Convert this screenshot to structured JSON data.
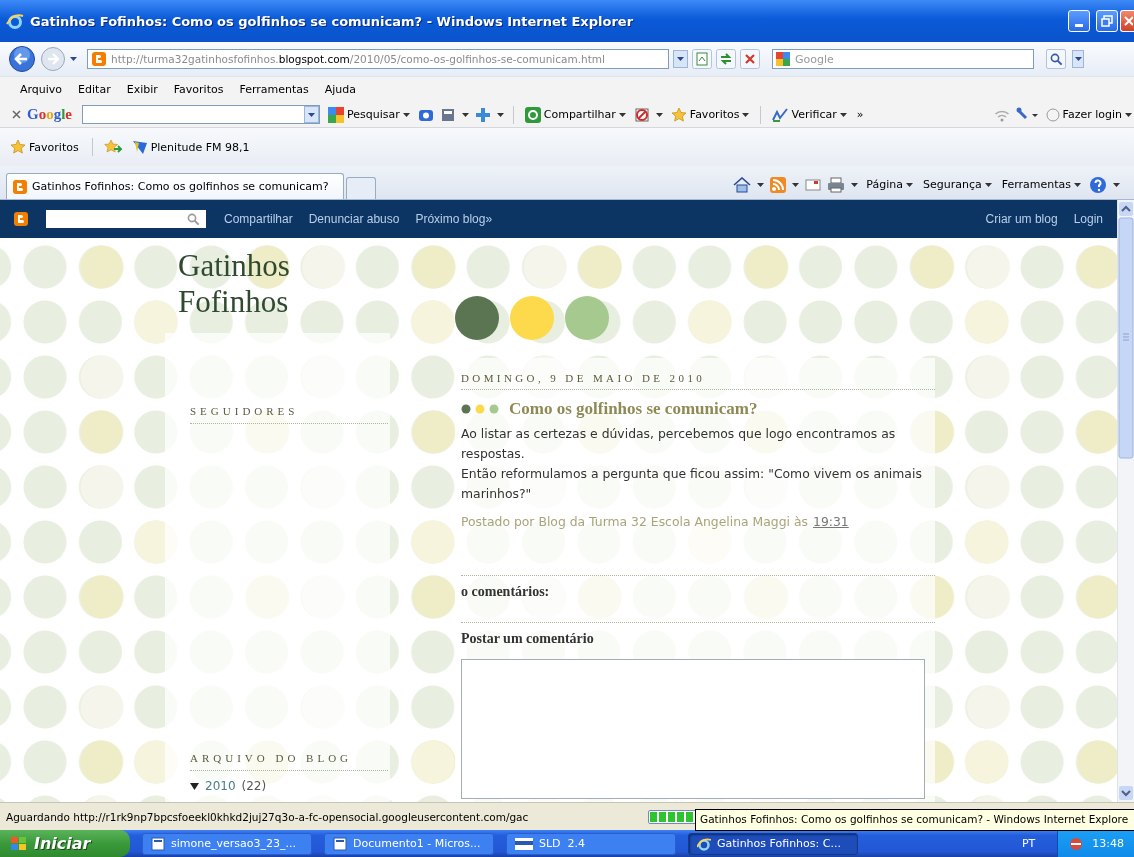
{
  "window": {
    "title": "Gatinhos Fofinhos: Como os golfinhos se comunicam? - Windows Internet Explorer"
  },
  "address_bar": {
    "url": "http://turma32gatinhosfofinhos.**blogspot.com**/2010/05/como-os-golfinhos-se-comunicam.html",
    "search_placeholder": "Google"
  },
  "menu": [
    "Arquivo",
    "Editar",
    "Exibir",
    "Favoritos",
    "Ferramentas",
    "Ajuda"
  ],
  "google_toolbar": {
    "logo": "Google",
    "items": [
      "Pesquisar",
      "Compartilhar",
      "Favoritos",
      "Verificar",
      "»",
      "Fazer login"
    ]
  },
  "favorites_bar": {
    "label": "Favoritos",
    "links": [
      "Plenitude FM 98,1"
    ]
  },
  "tabs": [
    {
      "label": "Gatinhos Fofinhos: Como os golfinhos se comunicam?",
      "selected": true
    }
  ],
  "command_bar": [
    "Página",
    "Segurança",
    "Ferramentas"
  ],
  "blogger_navbar": {
    "links": [
      "Compartilhar",
      "Denunciar abuso",
      "Próximo blog»"
    ],
    "right_links": [
      "Criar um blog",
      "Login"
    ]
  },
  "blog": {
    "title": "Gatinhos Fofinhos",
    "sidebar": [
      {
        "heading": "SEGUIDORES"
      },
      {
        "heading": "ARQUIVO DO BLOG",
        "archive": [
          {
            "year": "2010",
            "count": "(22)",
            "expanded": true
          }
        ]
      }
    ],
    "post": {
      "date": "DOMINGO, 9 DE MAIO DE 2010",
      "title": "Como os golfinhos se comunicam?",
      "paragraphs": [
        "Ao listar as certezas e dúvidas, percebemos que logo encontramos as respostas.",
        "Então reformulamos a pergunta que ficou assim: \"Como vivem os animais marinhos?\""
      ],
      "byline": "Postado por Blog da Turma 32 Escola Angelina Maggi às",
      "time": "19:31",
      "comments_heading": "o comentários:",
      "post_comment_heading": "Postar um comentário"
    }
  },
  "status_bar": {
    "text": "Aguardando http://r1rk9np7bpcsfoeekl0khkd2juj27q3o-a-fc-opensocial.googleusercontent.com/gac",
    "progress": {
      "level": 0.96
    },
    "tooltip": "Gatinhos Fofinhos: Como os golfinhos se comunicam? - Windows Internet Explore"
  },
  "taskbar": {
    "start": "Iniciar",
    "tasks": [
      {
        "label": "simone_versao3_23_...",
        "selected": false
      },
      {
        "label": "Documento1 - Micros...",
        "selected": false
      },
      {
        "label": "SLD  2.4",
        "selected": false
      },
      {
        "label": "Gatinhos Fofinhos: C...",
        "selected": true
      }
    ],
    "language": "PT",
    "clock": "13:48"
  }
}
